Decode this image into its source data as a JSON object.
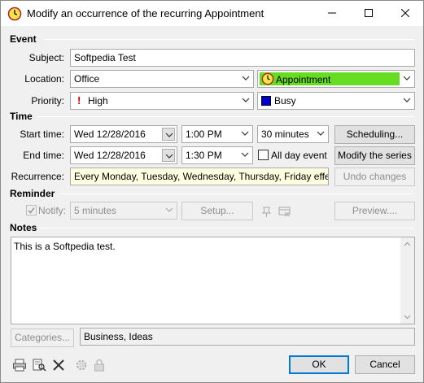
{
  "window": {
    "title": "Modify an occurrence of the recurring Appointment"
  },
  "sections": {
    "event": "Event",
    "time": "Time",
    "reminder": "Reminder",
    "notes": "Notes"
  },
  "event": {
    "subject_label": "Subject:",
    "subject_value": "Softpedia Test",
    "location_label": "Location:",
    "location_value": "Office",
    "label_value": "Appointment",
    "label_color": "#66dd22",
    "priority_label": "Priority:",
    "priority_value": "High",
    "show_as_value": "Busy",
    "show_as_color": "#0000cc"
  },
  "time": {
    "start_label": "Start time:",
    "start_date": "Wed 12/28/2016",
    "start_time": "1:00 PM",
    "duration": "30 minutes",
    "end_label": "End time:",
    "end_date": "Wed 12/28/2016",
    "end_time": "1:30 PM",
    "all_day_label": "All day event",
    "all_day_checked": false,
    "recurrence_label": "Recurrence:",
    "recurrence_value": "Every Monday, Tuesday, Wednesday, Thursday, Friday effective"
  },
  "buttons": {
    "scheduling": "Scheduling...",
    "modify_series": "Modify the series",
    "undo_changes": "Undo changes",
    "setup": "Setup...",
    "preview": "Preview....",
    "categories": "Categories...",
    "ok": "OK",
    "cancel": "Cancel"
  },
  "reminder": {
    "notify_label": "Notify:",
    "notify_checked": true,
    "notify_value": "5 minutes"
  },
  "notes": {
    "text": "This is a Softpedia test."
  },
  "categories": {
    "value": "Business, Ideas"
  }
}
